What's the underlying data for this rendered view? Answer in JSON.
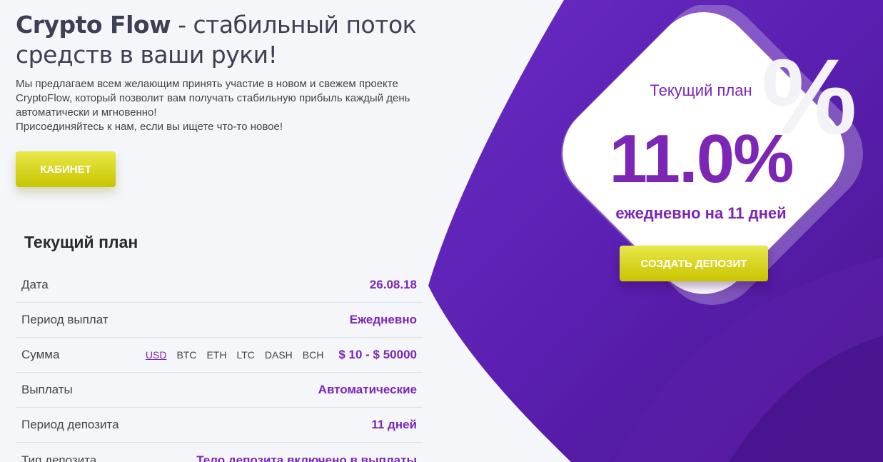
{
  "hero": {
    "brand": "Crypto Flow",
    "headline_rest": " - стабильный поток средств в ваши руки!",
    "intro_lines": [
      "Мы предлагаем всем желающим принять участие в новом и свежем проекте CryptoFlow, который позволит вам получать стабильную прибыль каждый день автоматически и мгновенно!",
      "Присоединяйтесь к нам, если вы ищете что-то новое!"
    ],
    "cabinet_label": "Кабинет"
  },
  "plan": {
    "title": "Текущий план",
    "rows": [
      {
        "label": "Дата",
        "value": "26.08.18"
      },
      {
        "label": "Период выплат",
        "value": "Ежедневно"
      },
      {
        "label": "Сумма",
        "value": "$ 10 - $ 50000"
      },
      {
        "label": "Выплаты",
        "value": "Автоматические"
      },
      {
        "label": "Период депозита",
        "value": "11 дней"
      },
      {
        "label": "Тип депозита",
        "value": "Тело депозита включено в выплаты"
      }
    ],
    "currencies": [
      "USD",
      "BTC",
      "ETH",
      "LTC",
      "DASH",
      "BCH"
    ],
    "selected_currency": "USD"
  },
  "card": {
    "subtitle": "Текущий план",
    "rate": "11.0%",
    "period": "ежедневно на 11 дней",
    "deposit_label": "Создать депозит"
  },
  "colors": {
    "accent": "#7b26b5",
    "button": "#d6d21a",
    "purple_dark": "#4b1596",
    "background": "#f5f6fa"
  }
}
